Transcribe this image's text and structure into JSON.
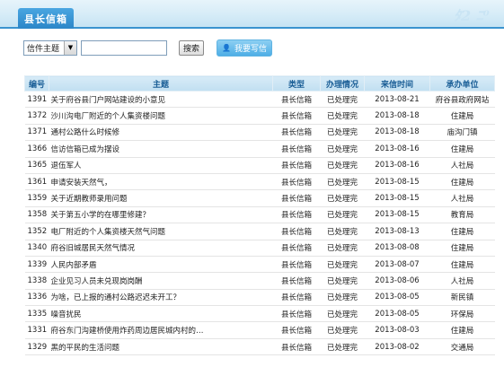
{
  "header": {
    "tab_label": "县长信箱",
    "deco_text": "ﾀ2 ﾆ⁰"
  },
  "search": {
    "select_value": "信件主题",
    "input_placeholder": "",
    "search_label": "搜索",
    "write_label": "我要写信"
  },
  "table": {
    "columns": [
      "编号",
      "主题",
      "类型",
      "办理情况",
      "来信时间",
      "承办单位"
    ],
    "rows": [
      {
        "no": "1391",
        "subject": "关于府谷县门户网站建设的小意见",
        "type": "县长信箱",
        "status": "已处理完",
        "date": "2013-08-21",
        "dept": "府谷县政府网站"
      },
      {
        "no": "1372",
        "subject": "沙川沟电厂附近的个人集资楼问题",
        "type": "县长信箱",
        "status": "已处理完",
        "date": "2013-08-18",
        "dept": "住建局"
      },
      {
        "no": "1371",
        "subject": "通村公路什么时候修",
        "type": "县长信箱",
        "status": "已处理完",
        "date": "2013-08-18",
        "dept": "庙沟门镇"
      },
      {
        "no": "1366",
        "subject": "信访信箱已成为摆设",
        "type": "县长信箱",
        "status": "已处理完",
        "date": "2013-08-16",
        "dept": "住建局"
      },
      {
        "no": "1365",
        "subject": "退伍军人",
        "type": "县长信箱",
        "status": "已处理完",
        "date": "2013-08-16",
        "dept": "人社局"
      },
      {
        "no": "1361",
        "subject": "申请安装天然气，",
        "type": "县长信箱",
        "status": "已处理完",
        "date": "2013-08-15",
        "dept": "住建局"
      },
      {
        "no": "1359",
        "subject": "关于近期教师录用问题",
        "type": "县长信箱",
        "status": "已处理完",
        "date": "2013-08-15",
        "dept": "人社局"
      },
      {
        "no": "1358",
        "subject": "关于第五小学的在哪里修建？",
        "type": "县长信箱",
        "status": "已处理完",
        "date": "2013-08-15",
        "dept": "教育局"
      },
      {
        "no": "1352",
        "subject": "电厂附近的个人集资楼天然气问题",
        "type": "县长信箱",
        "status": "已处理完",
        "date": "2013-08-13",
        "dept": "住建局"
      },
      {
        "no": "1340",
        "subject": "府谷旧城居民天然气情况",
        "type": "县长信箱",
        "status": "已处理完",
        "date": "2013-08-08",
        "dept": "住建局"
      },
      {
        "no": "1339",
        "subject": "人民内部矛盾",
        "type": "县长信箱",
        "status": "已处理完",
        "date": "2013-08-07",
        "dept": "住建局"
      },
      {
        "no": "1338",
        "subject": "企业见习人员未兑现岗岗酬",
        "type": "县长信箱",
        "status": "已处理完",
        "date": "2013-08-06",
        "dept": "人社局"
      },
      {
        "no": "1336",
        "subject": "为啥，已上报的通村公路迟迟未开工？",
        "type": "县长信箱",
        "status": "已处理完",
        "date": "2013-08-05",
        "dept": "新民镇"
      },
      {
        "no": "1335",
        "subject": "噪音扰民",
        "type": "县长信箱",
        "status": "已处理完",
        "date": "2013-08-05",
        "dept": "环保局"
      },
      {
        "no": "1331",
        "subject": "府谷东门沟建桥使用炸药周边居民城内村的…",
        "type": "县长信箱",
        "status": "已处理完",
        "date": "2013-08-03",
        "dept": "住建局"
      },
      {
        "no": "1329",
        "subject": "黑的平民的生活问题",
        "type": "县长信箱",
        "status": "已处理完",
        "date": "2013-08-02",
        "dept": "交通局"
      }
    ]
  },
  "colors": {
    "accent": "#2b86c8",
    "header_bg": "#d4ebf7",
    "th_text": "#1a5e96"
  },
  "icons": {
    "write": "user-icon",
    "select_arrow": "chevron-down-icon"
  }
}
